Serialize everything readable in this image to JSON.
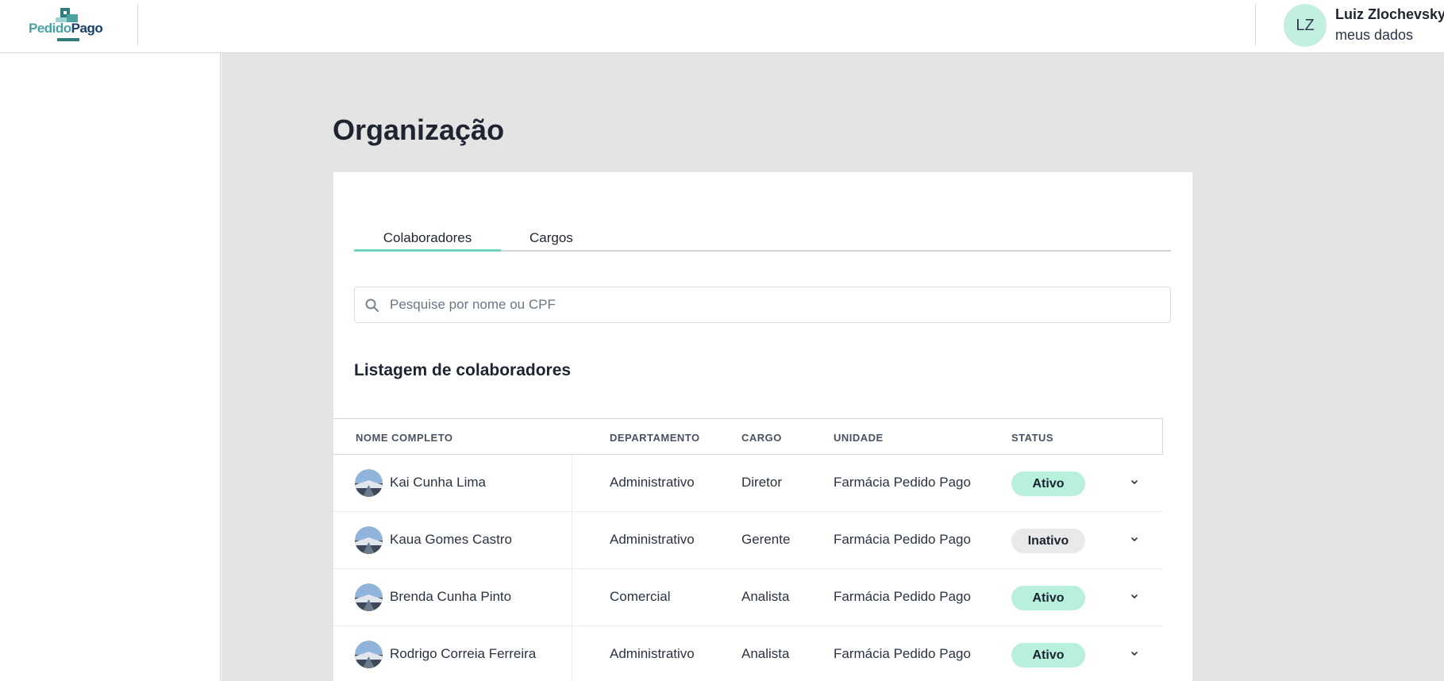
{
  "brand": {
    "name_part1": "Pedido",
    "name_part2": "Pago"
  },
  "user": {
    "initials": "LZ",
    "name": "Luiz Zlochevsky",
    "profile_link": "meus dados"
  },
  "page": {
    "title": "Organização"
  },
  "tabs": [
    {
      "label": "Colaboradores",
      "active": true
    },
    {
      "label": "Cargos",
      "active": false
    }
  ],
  "search": {
    "placeholder": "Pesquise por nome ou CPF",
    "value": ""
  },
  "list": {
    "title": "Listagem de colaboradores",
    "columns": [
      "NOME COMPLETO",
      "DEPARTAMENTO",
      "CARGO",
      "UNIDADE",
      "STATUS"
    ],
    "rows": [
      {
        "name": "Kai Cunha Lima",
        "department": "Administrativo",
        "role": "Diretor",
        "unit": "Farmácia Pedido Pago",
        "status": "Ativo"
      },
      {
        "name": "Kaua Gomes Castro",
        "department": "Administrativo",
        "role": "Gerente",
        "unit": "Farmácia Pedido Pago",
        "status": "Inativo"
      },
      {
        "name": "Brenda Cunha Pinto",
        "department": "Comercial",
        "role": "Analista",
        "unit": "Farmácia Pedido Pago",
        "status": "Ativo"
      },
      {
        "name": "Rodrigo Correia Ferreira",
        "department": "Administrativo",
        "role": "Analista",
        "unit": "Farmácia Pedido Pago",
        "status": "Ativo"
      }
    ]
  },
  "colors": {
    "accent": "#6fd4bb",
    "badge_active": "#b9f0dc",
    "badge_inactive": "#e9e9e9",
    "avatar_bg": "#c3efe0",
    "content_bg": "#e4e4e4",
    "brand_teal": "#4aa3a0",
    "brand_navy": "#1c3f6b"
  },
  "icons": {
    "search": "search-icon",
    "row_expand": "chevron-down-icon",
    "row_avatar": "avatar"
  }
}
